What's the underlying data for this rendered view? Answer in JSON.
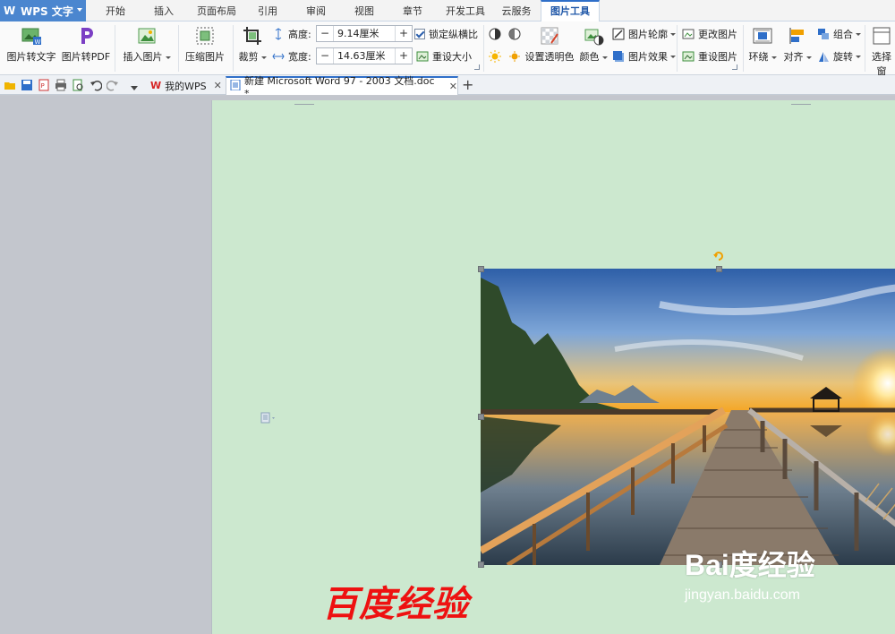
{
  "app": {
    "name": "WPS 文字"
  },
  "menu_tabs": [
    {
      "label": "开始"
    },
    {
      "label": "插入"
    },
    {
      "label": "页面布局"
    },
    {
      "label": "引用"
    },
    {
      "label": "审阅"
    },
    {
      "label": "视图"
    },
    {
      "label": "章节"
    },
    {
      "label": "开发工具"
    },
    {
      "label": "云服务"
    },
    {
      "label": "图片工具"
    }
  ],
  "active_menu_tab": "图片工具",
  "ribbon": {
    "pic_to_text": "图片转文字",
    "pic_to_pdf": "图片转PDF",
    "insert_picture": "插入图片",
    "compress_picture": "压缩图片",
    "crop": "裁剪",
    "height_label": "高度:",
    "height_value": "9.14厘米",
    "width_label": "宽度:",
    "width_value": "14.63厘米",
    "lock_aspect": "锁定纵横比",
    "reset_size": "重设大小",
    "set_transparent": "设置透明色",
    "color": "颜色",
    "picture_outline": "图片轮廓",
    "picture_effect": "图片效果",
    "change_picture": "更改图片",
    "reset_picture": "重设图片",
    "wrap": "环绕",
    "align": "对齐",
    "group": "组合",
    "rotate": "旋转",
    "select_pane": "选择窗"
  },
  "doc_tabs": [
    {
      "label": "我的WPS"
    },
    {
      "label": "新建 Microsoft Word 97 - 2003 文档.doc *"
    }
  ],
  "document": {
    "title_text": "百度经验",
    "watermark_logo": "Bai度经验",
    "watermark_url": "jingyan.baidu.com"
  },
  "colors": {
    "brand_blue": "#4b86cf",
    "page_green": "#cce8cf",
    "title_red": "#ee1111"
  }
}
